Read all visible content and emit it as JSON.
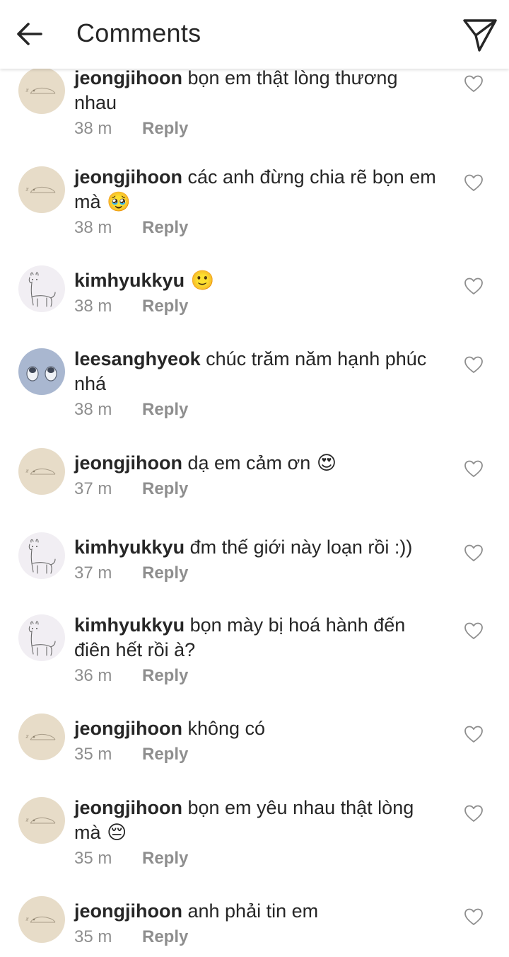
{
  "header": {
    "title": "Comments",
    "back_icon": "arrow-left-icon",
    "send_icon": "paper-plane-icon"
  },
  "avatars": {
    "jeongjihoon": {
      "bg": "#e7dcc8",
      "icon": "sleeping-seal-doodle"
    },
    "kimhyukkyu": {
      "bg": "#f1eef3",
      "icon": "alpaca-doodle"
    },
    "leesanghyeok": {
      "bg": "#a9b7d0",
      "icon": "penguins-doodle"
    }
  },
  "reply_label": "Reply",
  "comments": [
    {
      "user": "jeongjihoon",
      "avatar": "jeongjihoon",
      "text": "bọn em thật lòng thương nhau",
      "emoji": "",
      "time": "38 m"
    },
    {
      "user": "jeongjihoon",
      "avatar": "jeongjihoon",
      "text": "các anh đừng chia rẽ bọn em mà",
      "emoji": "🥹",
      "time": "38 m"
    },
    {
      "user": "kimhyukkyu",
      "avatar": "kimhyukkyu",
      "text": "",
      "emoji": "🙂",
      "time": "38 m"
    },
    {
      "user": "leesanghyeok",
      "avatar": "leesanghyeok",
      "text": "chúc trăm năm hạnh phúc nhá",
      "emoji": "",
      "time": "38 m"
    },
    {
      "user": "jeongjihoon",
      "avatar": "jeongjihoon",
      "text": "dạ em cảm ơn",
      "emoji": "😍",
      "time": "37 m"
    },
    {
      "user": "kimhyukkyu",
      "avatar": "kimhyukkyu",
      "text": "đm thế giới này loạn rồi :))",
      "emoji": "",
      "time": "37 m"
    },
    {
      "user": "kimhyukkyu",
      "avatar": "kimhyukkyu",
      "text": "bọn mày bị hoá hành đến điên hết rồi à?",
      "emoji": "",
      "time": "36 m"
    },
    {
      "user": "jeongjihoon",
      "avatar": "jeongjihoon",
      "text": "không có",
      "emoji": "",
      "time": "35 m"
    },
    {
      "user": "jeongjihoon",
      "avatar": "jeongjihoon",
      "text": "bọn em yêu nhau thật lòng mà",
      "emoji": "😔",
      "time": "35 m"
    },
    {
      "user": "jeongjihoon",
      "avatar": "jeongjihoon",
      "text": "anh phải tin em",
      "emoji": "",
      "time": "35 m"
    }
  ]
}
